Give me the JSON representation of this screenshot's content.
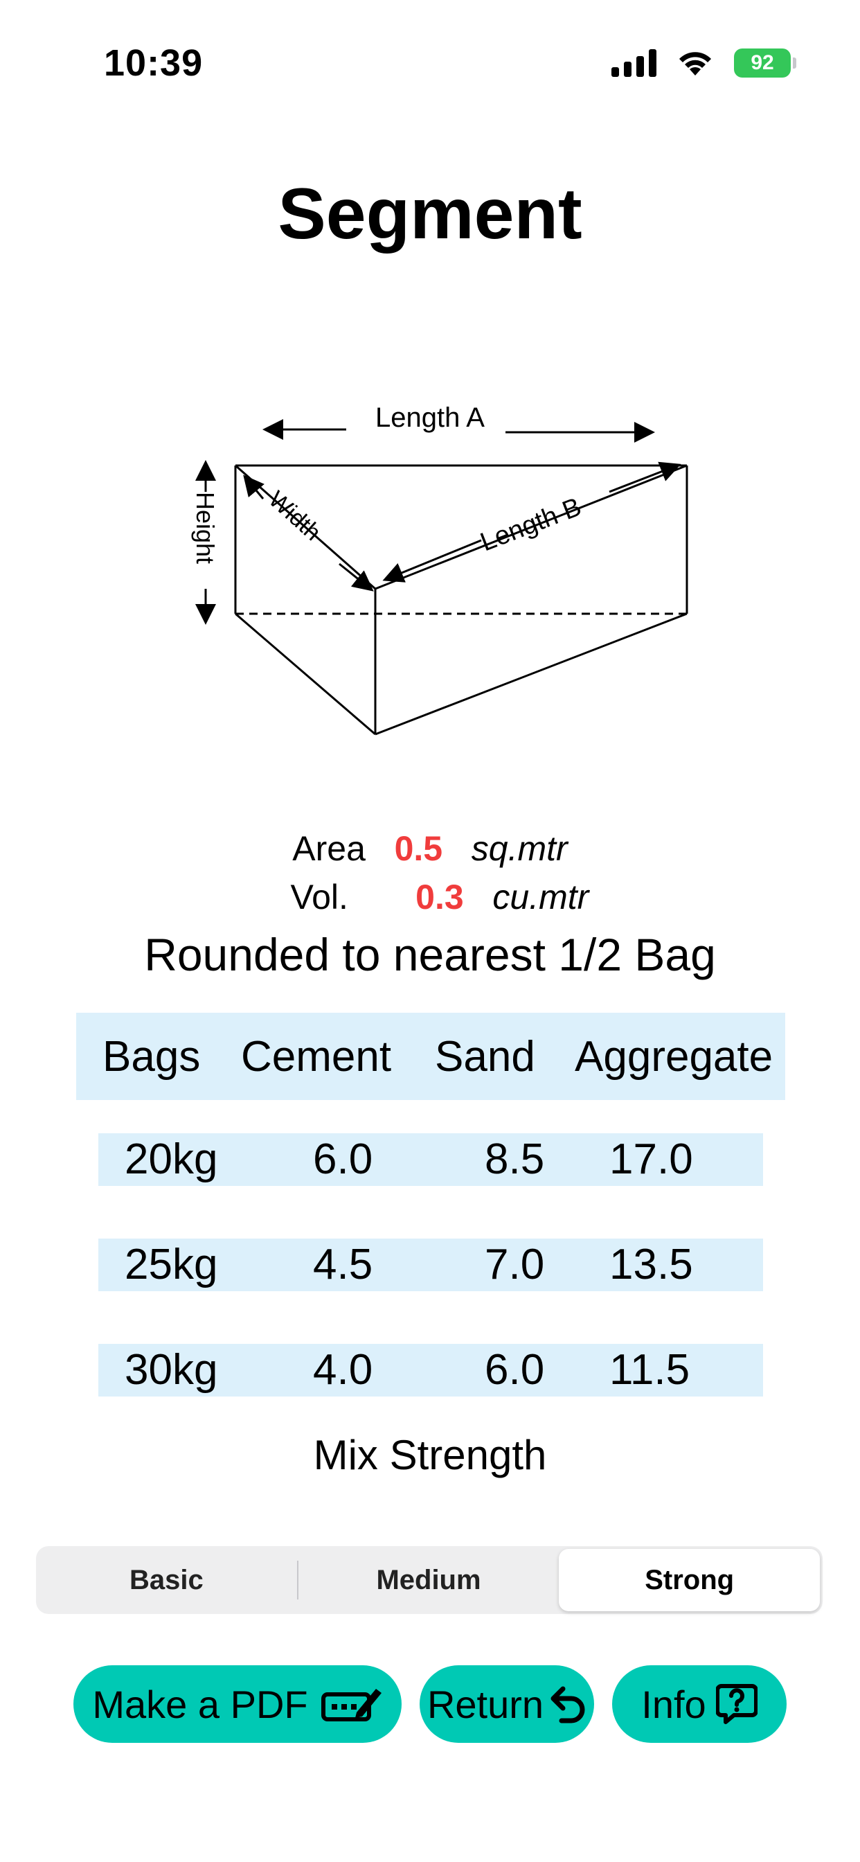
{
  "status_bar": {
    "time": "10:39",
    "battery": "92"
  },
  "page": {
    "title": "Segment"
  },
  "diagram": {
    "length_a": "Length A",
    "length_b": "Length B",
    "width": "Width",
    "height": "Height"
  },
  "results": {
    "area_label": "Area",
    "area_value": "0.5",
    "area_unit": "sq.mtr",
    "vol_label": "Vol.",
    "vol_value": "0.3",
    "vol_unit": "cu.mtr",
    "rounded_note": "Rounded to nearest 1/2 Bag"
  },
  "table": {
    "headers": [
      "Bags",
      "Cement",
      "Sand",
      "Aggregate"
    ],
    "rows": [
      [
        "20kg",
        "6.0",
        "8.5",
        "17.0"
      ],
      [
        "25kg",
        "4.5",
        "7.0",
        "13.5"
      ],
      [
        "30kg",
        "4.0",
        "6.0",
        "11.5"
      ]
    ]
  },
  "mix": {
    "label": "Mix Strength",
    "options": [
      "Basic",
      "Medium",
      "Strong"
    ],
    "selected": "Strong"
  },
  "buttons": {
    "pdf": "Make a PDF",
    "return": "Return",
    "info": "Info"
  },
  "colors": {
    "accent": "#00c9b4",
    "highlight": "#f03c3c",
    "table_bg": "#dcf0fb"
  }
}
